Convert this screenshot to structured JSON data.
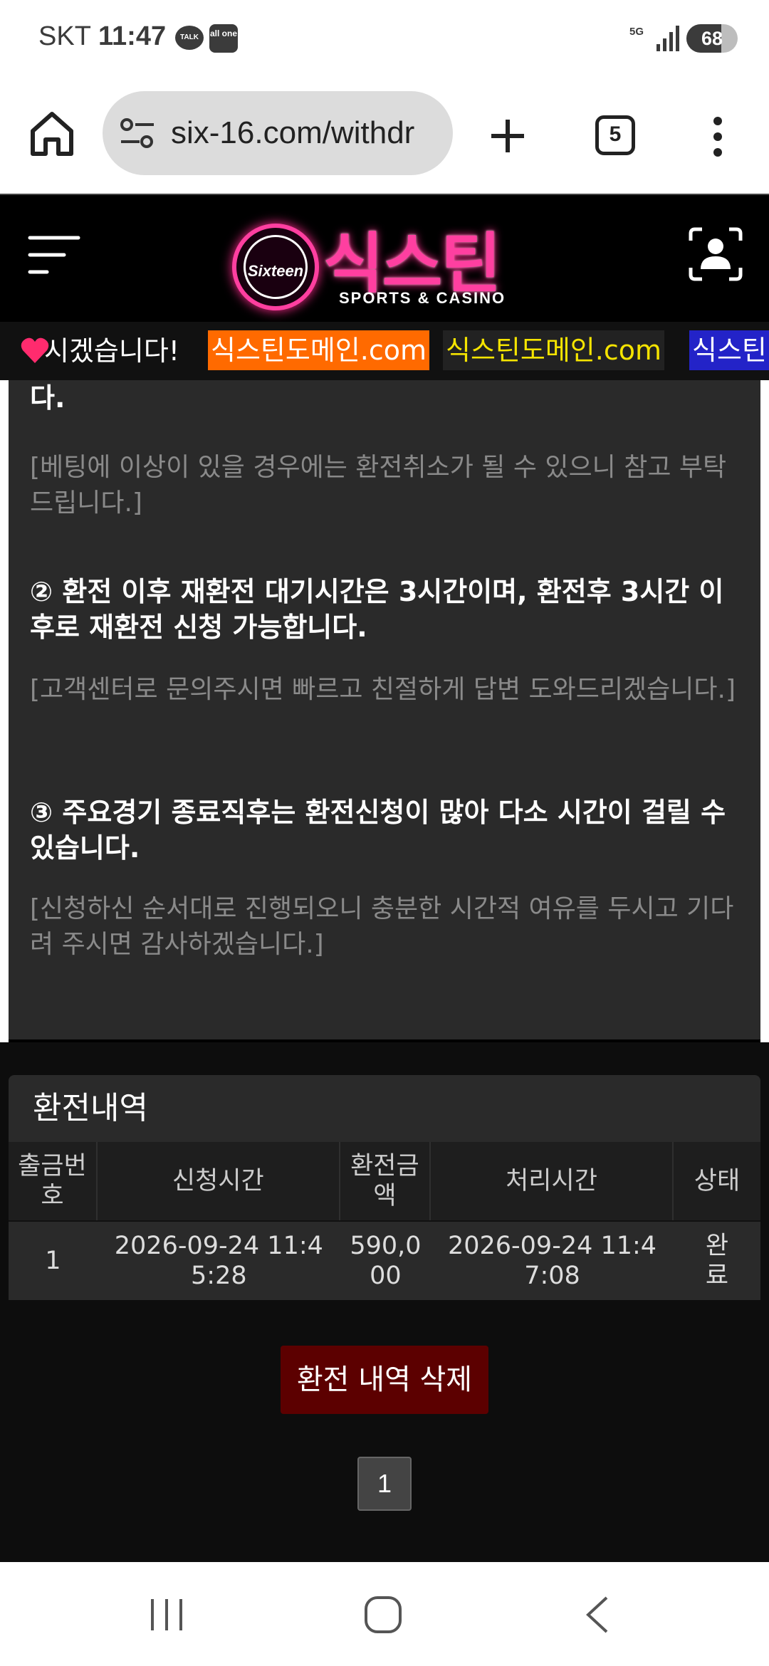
{
  "status_bar": {
    "carrier": "SKT",
    "time": "11:47",
    "talk_badge": "TALK",
    "allone_badge": "all one",
    "network": "5G",
    "battery": "68",
    "battery_level": 0.68
  },
  "browser": {
    "url": "six-16.com/withdr",
    "tab_count": "5"
  },
  "site": {
    "logo_circle_text": "Sixteen",
    "logo_text": "식스틴",
    "logo_subtitle": "SPORTS & CASINO"
  },
  "ticker": {
    "text": "시겠습니다!",
    "domains": [
      "식스틴도메인.com",
      "식스틴도메인.com",
      "식스틴"
    ],
    "colors": [
      "#ff6a00",
      "#f5e400",
      "#2323c8"
    ]
  },
  "notice": {
    "item1_tail": "다.",
    "item1_sub": "[베팅에 이상이 있을 경우에는 환전취소가 될 수 있으니 참고 부탁드립니다.]",
    "item2_title": "② 환전 이후 재환전 대기시간은 3시간이며, 환전후 3시간 이후로 재환전 신청 가능합니다.",
    "item2_sub": "[고객센터로 문의주시면 빠르고 친절하게 답변 도와드리겠습니다.]",
    "item3_title": "③ 주요경기 종료직후는 환전신청이 많아 다소 시간이 걸릴 수 있습니다.",
    "item3_sub": "[신청하신 순서대로 진행되오니 충분한 시간적 여유를 두시고 기다려 주시면 감사하겠습니다.]"
  },
  "history": {
    "title": "환전내역",
    "columns": [
      "출금번호",
      "신청시간",
      "환전금액",
      "처리시간",
      "상태"
    ],
    "rows": [
      {
        "no": "1",
        "requested": "2026-09-24 11:45:28",
        "amount": "590,000",
        "processed": "2026-09-24 11:47:08",
        "status": "완료"
      }
    ],
    "delete_label": "환전 내역 삭제",
    "page": "1"
  }
}
